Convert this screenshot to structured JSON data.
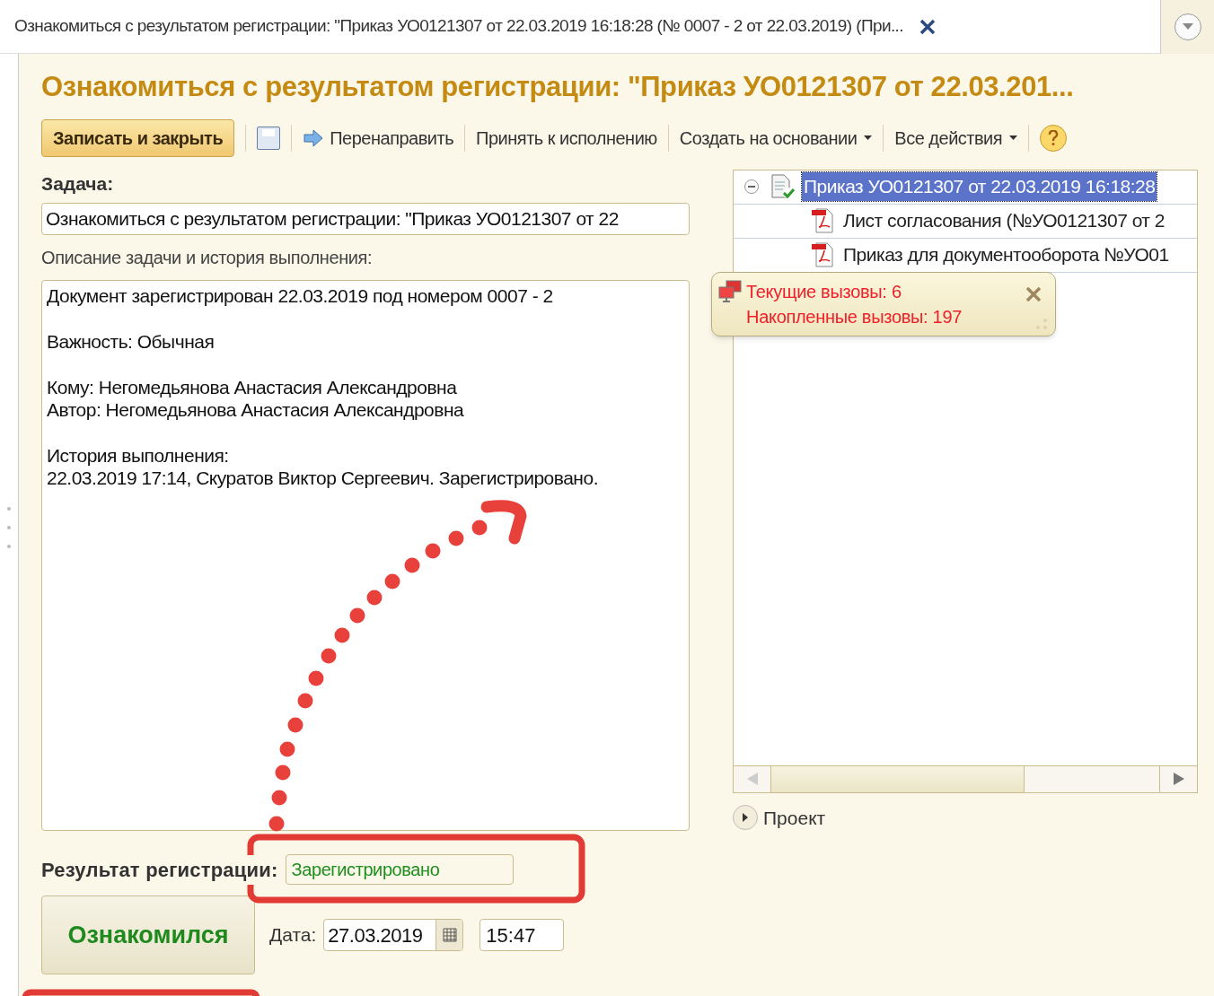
{
  "tab": {
    "title": "Ознакомиться с результатом регистрации: \"Приказ УО0121307 от 22.03.2019 16:18:28 (№ 0007 - 2 от 22.03.2019) (При...",
    "closable": true
  },
  "form": {
    "title": "Ознакомиться с результатом регистрации: \"Приказ УО0121307 от 22.03.201..."
  },
  "toolbar": [
    {
      "kind": "primary",
      "label": "Записать и закрыть"
    },
    {
      "kind": "save"
    },
    {
      "kind": "forward",
      "label": "Перенаправить"
    },
    {
      "kind": "plain",
      "label": "Принять к исполнению"
    },
    {
      "kind": "menu",
      "label": "Создать на основании"
    },
    {
      "kind": "menu",
      "label": "Все действия"
    },
    {
      "kind": "help"
    }
  ],
  "task": {
    "label": "Задача:",
    "value": "Ознакомиться с результатом регистрации: \"Приказ УО0121307 от 22"
  },
  "description": {
    "label": "Описание задачи и история выполнения:",
    "paragraphs": [
      [
        "Документ зарегистрирован 22.03.2019 под номером 0007 - 2"
      ],
      [
        "Важность: Обычная"
      ],
      [
        "Кому: Негомедьянова Анастасия Александровна",
        "Автор: Негомедьянова Анастасия Александровна"
      ],
      [
        "История выполнения:",
        "22.03.2019 17:14, Скуратов Виктор Сергеевич. Зарегистрировано."
      ]
    ]
  },
  "result": {
    "label": "Результат регистрации:",
    "value": "Зарегистрировано"
  },
  "acknowledge_button": "Ознакомился",
  "date": {
    "label": "Дата:",
    "value": "27.03.2019",
    "time": "15:47"
  },
  "tree": [
    {
      "label": "Приказ УО0121307 от 22.03.2019 16:18:28",
      "kind": "document",
      "selected": true,
      "expanded": true,
      "children": [
        {
          "label": "Лист согласования (№УО0121307 от 2",
          "kind": "pdf",
          "selected": false
        },
        {
          "label": "Приказ для документооборота №УО01",
          "kind": "pdf",
          "selected": false
        }
      ]
    }
  ],
  "project": {
    "label": "Проект",
    "expanded": false
  },
  "tooltip": {
    "lines": [
      "Текущие вызовы: 6",
      "Накопленные вызовы: 197"
    ]
  }
}
